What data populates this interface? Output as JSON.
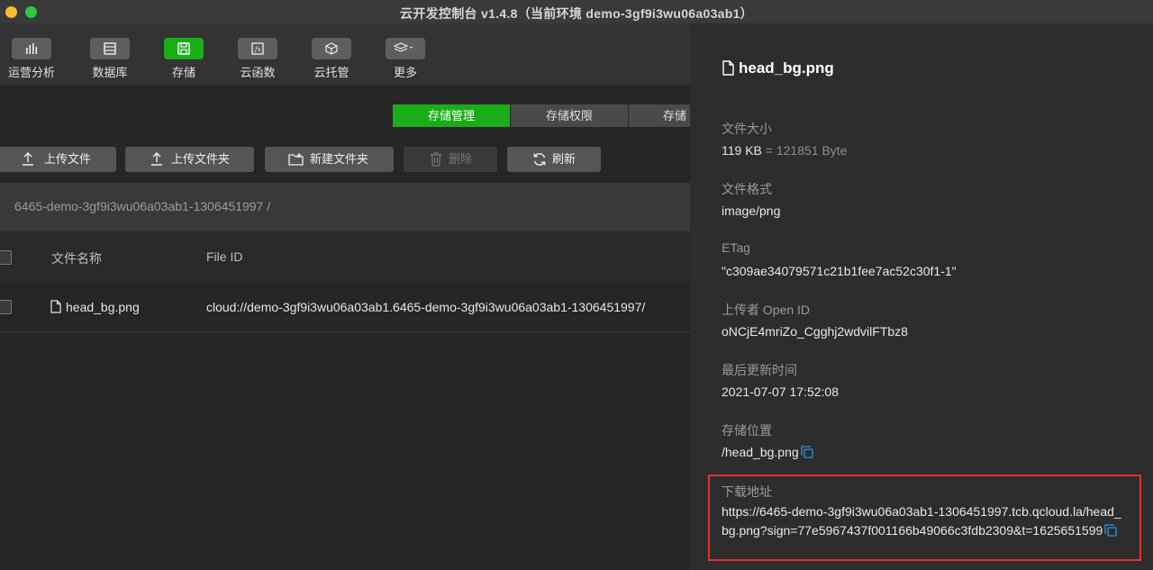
{
  "window": {
    "title": "云开发控制台 v1.4.8（当前环境 demo-3gf9i3wu06a03ab1）"
  },
  "toolbar": {
    "items": [
      {
        "label": "运营分析",
        "icon": "bar-chart-icon"
      },
      {
        "label": "数据库",
        "icon": "database-icon"
      },
      {
        "label": "存储",
        "icon": "storage-icon",
        "active": true
      },
      {
        "label": "云函数",
        "icon": "function-icon"
      },
      {
        "label": "云托管",
        "icon": "cube-icon"
      },
      {
        "label": "更多",
        "icon": "layers-icon"
      }
    ]
  },
  "tabs": [
    "存储管理",
    "存储权限",
    "存储"
  ],
  "actions": {
    "upload_file": "上传文件",
    "upload_folder": "上传文件夹",
    "new_folder": "新建文件夹",
    "delete": "删除",
    "refresh": "刷新"
  },
  "path": "6465-demo-3gf9i3wu06a03ab1-1306451997 /",
  "table": {
    "headers": {
      "name": "文件名称",
      "file_id": "File ID"
    },
    "rows": [
      {
        "name": "head_bg.png",
        "file_id": "cloud://demo-3gf9i3wu06a03ab1.6465-demo-3gf9i3wu06a03ab1-1306451997/"
      }
    ]
  },
  "details": {
    "title": "head_bg.png",
    "size_label": "文件大小",
    "size_value": "119 KB",
    "size_bytes": "= 121851 Byte",
    "format_label": "文件格式",
    "format_value": "image/png",
    "etag_label": "ETag",
    "etag_value": "\"c309ae34079571c21b1fee7ac52c30f1-1\"",
    "uploader_label": "上传者 Open ID",
    "uploader_value": "oNCjE4mriZo_Cgghj2wdvilFTbz8",
    "updated_label": "最后更新时间",
    "updated_value": "2021-07-07 17:52:08",
    "location_label": "存储位置",
    "location_value": "/head_bg.png",
    "download_label": "下载地址",
    "download_value": "https://6465-demo-3gf9i3wu06a03ab1-1306451997.tcb.qcloud.la/head_bg.png?sign=77e5967437f001166b49066c3fdb2309&t=1625651599"
  },
  "colors": {
    "accent": "#1aad19",
    "highlight": "#e03232",
    "link": "#2f8fe8"
  }
}
